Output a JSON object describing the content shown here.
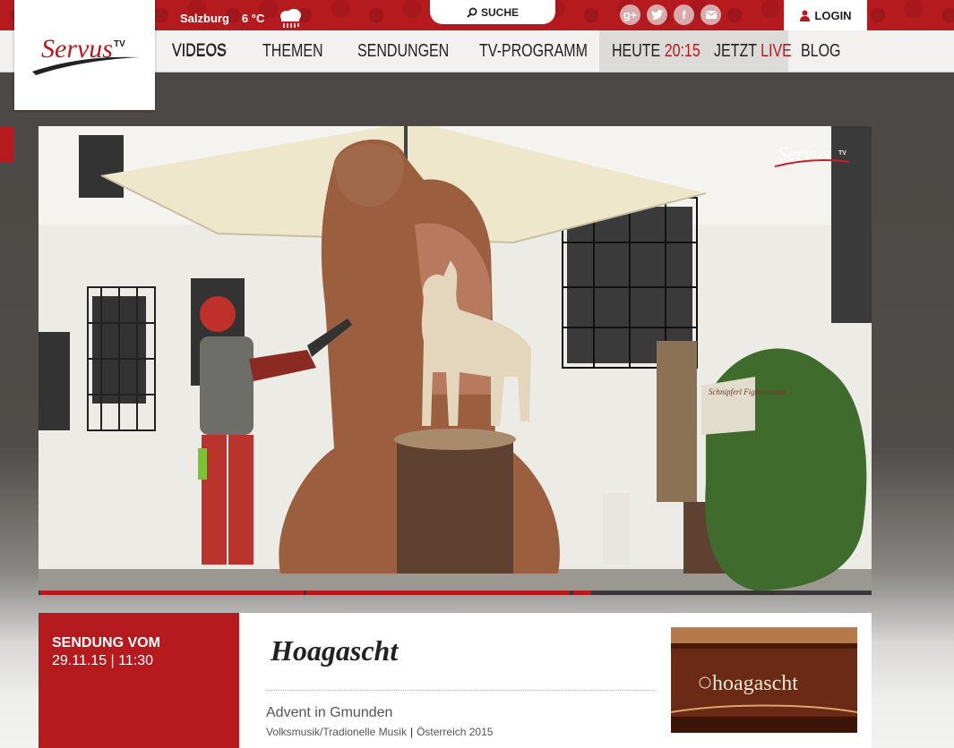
{
  "topbar": {
    "city": "Salzburg",
    "temperature": "6 °C",
    "weather_icon": "cloud-rain-icon",
    "search_label": "SUCHE",
    "social": [
      "google-plus",
      "twitter",
      "facebook",
      "mail"
    ],
    "login_label": "LOGIN"
  },
  "logo": {
    "text": "Servus",
    "suffix": "TV"
  },
  "nav": {
    "videos": "VIDEOS",
    "themen": "THEMEN",
    "sendungen": "SENDUNGEN",
    "tvprogramm": "TV-PROGRAMM",
    "heute_label": "HEUTE",
    "heute_time": "20:15",
    "jetzt_label": "JETZT",
    "jetzt_live": "LIVE",
    "blog": "BLOG"
  },
  "video": {
    "watermark": "Servus",
    "watermark_suffix": "TV",
    "sign_text": "Schnipferl Figurenkunst",
    "progress_segments": 3
  },
  "episode": {
    "date_label": "SENDUNG VOM",
    "date": "29.11.15",
    "time": "11:30",
    "show_title": "Hoagascht",
    "subtitle": "Advent in Gmunden",
    "genre": "Volksmusik/Tradionelle Musik",
    "country_year": "Österreich 2015",
    "thumb_title": "hoagascht"
  },
  "colors": {
    "brand_red": "#b51a1f",
    "nav_bg": "#f2f1ef"
  }
}
